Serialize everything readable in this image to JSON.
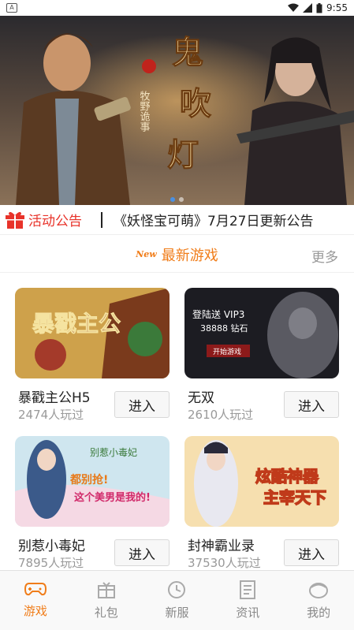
{
  "status_bar": {
    "time": "9:55"
  },
  "notice": {
    "label": "活动公告",
    "text": "《妖怪宝可萌》7月27日更新公告"
  },
  "section": {
    "badge": "New",
    "title": "最新游戏",
    "more": "更多"
  },
  "banner": {
    "art_text": "鬼吹灯",
    "sub_text": "牧野诡事"
  },
  "games": [
    {
      "name": "暴戳主公H5",
      "plays": "2474人玩过",
      "button": "进入",
      "thumb_text": "暴戳主公"
    },
    {
      "name": "无双",
      "plays": "2610人玩过",
      "button": "进入",
      "thumb_text": "登陆送 VIP3",
      "thumb_text2": "38888 钻石",
      "thumb_btn": "开始游戏"
    },
    {
      "name": "别惹小毒妃",
      "plays": "7895人玩过",
      "button": "进入",
      "thumb_text": "别惹小毒妃"
    },
    {
      "name": "封神霸业录",
      "plays": "37530人玩过",
      "button": "进入",
      "thumb_text": "炫酷神器",
      "thumb_text2": "主宰天下"
    }
  ],
  "tabs": [
    {
      "label": "游戏",
      "icon": "gamepad-icon",
      "active": true
    },
    {
      "label": "礼包",
      "icon": "gift-box-icon",
      "active": false
    },
    {
      "label": "新服",
      "icon": "clock-icon",
      "active": false
    },
    {
      "label": "资讯",
      "icon": "news-icon",
      "active": false
    },
    {
      "label": "我的",
      "icon": "profile-icon",
      "active": false
    }
  ],
  "colors": {
    "accent": "#f07d1a",
    "notice_red": "#e8332a"
  }
}
